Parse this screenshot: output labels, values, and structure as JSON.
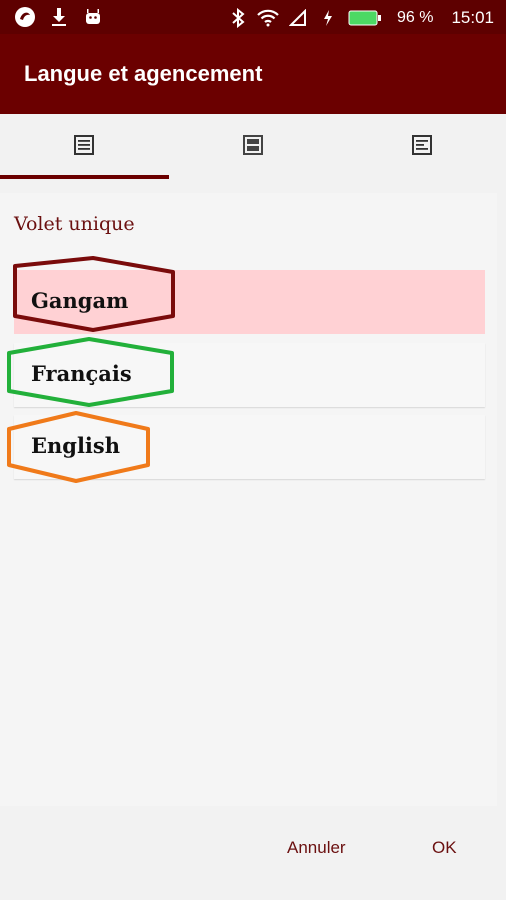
{
  "status_bar": {
    "battery": "96 %",
    "time": "15:01",
    "icons": [
      "app-logo-icon",
      "download-icon",
      "android-icon",
      "bluetooth-icon",
      "wifi-icon",
      "signal-icon",
      "charging-icon",
      "battery-icon"
    ]
  },
  "app_bar": {
    "title": "Langue et agencement"
  },
  "tabs": [
    {
      "icon": "single-pane-icon",
      "selected": true
    },
    {
      "icon": "split-pane-icon",
      "selected": false
    },
    {
      "icon": "text-layout-icon",
      "selected": false
    }
  ],
  "section": {
    "title": "Volet unique"
  },
  "languages": [
    {
      "label": "Gangam",
      "selected": true,
      "outline_color": "#7a0b0b"
    },
    {
      "label": "Français",
      "selected": false,
      "outline_color": "#22b03a"
    },
    {
      "label": "English",
      "selected": false,
      "outline_color": "#f07a1a"
    }
  ],
  "buttons": {
    "cancel": "Annuler",
    "ok": "OK"
  },
  "colors": {
    "primary": "#6b0000",
    "status_bar": "#5e0000",
    "selected_row": "#ffd1d4",
    "accent_text": "#6b1010"
  }
}
